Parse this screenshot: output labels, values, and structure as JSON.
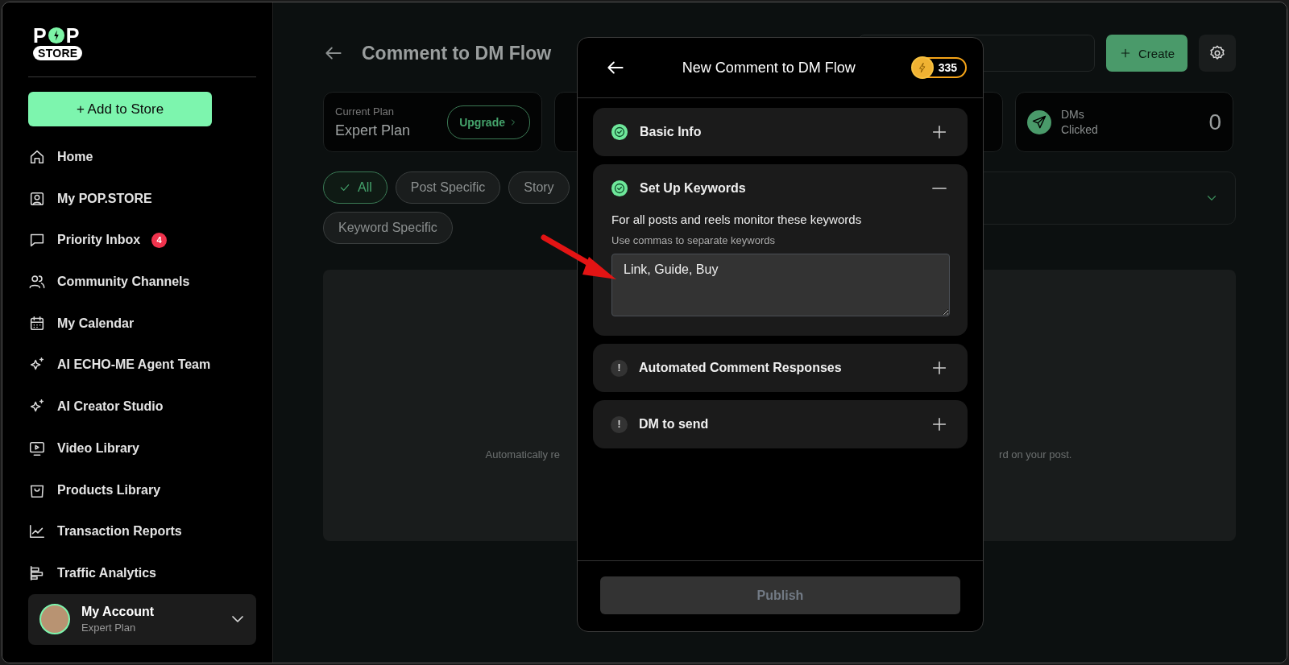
{
  "sidebar": {
    "logo": {
      "left": "P",
      "right": "P",
      "bottom": "STORE"
    },
    "add_button": "+ Add to Store",
    "items": [
      {
        "label": "Home",
        "kind": "home"
      },
      {
        "label": "My POP.STORE",
        "kind": "profile"
      },
      {
        "label": "Priority Inbox",
        "kind": "chat",
        "badge": "4"
      },
      {
        "label": "Community Channels",
        "kind": "people"
      },
      {
        "label": "My Calendar",
        "kind": "calendar"
      },
      {
        "label": "AI ECHO-ME Agent Team",
        "kind": "sparkle"
      },
      {
        "label": "AI Creator Studio",
        "kind": "sparkle"
      },
      {
        "label": "Video Library",
        "kind": "video"
      },
      {
        "label": "Products Library",
        "kind": "bag"
      },
      {
        "label": "Transaction Reports",
        "kind": "chart"
      },
      {
        "label": "Traffic Analytics",
        "kind": "bars"
      }
    ],
    "account": {
      "name": "My Account",
      "plan": "Expert Plan"
    }
  },
  "main": {
    "title": "Comment to DM Flow",
    "create_button": "Create",
    "stats": [
      {
        "kind": "plan",
        "label": "Current Plan",
        "value": "Expert Plan",
        "button": "Upgrade"
      },
      {
        "kind": "covered"
      },
      {
        "kind": "covered"
      },
      {
        "kind": "metric",
        "label": "DMs Clicked",
        "value": "0"
      }
    ],
    "filters": [
      {
        "label": "All",
        "selected": true
      },
      {
        "label": "Post Specific",
        "selected": false
      },
      {
        "label": "Story",
        "selected": false
      },
      {
        "label": "Keyword Specific",
        "selected": false
      }
    ],
    "empty_text": {
      "left": "Automatically re",
      "right": "rd on your post."
    }
  },
  "modal": {
    "title": "New Comment to DM Flow",
    "credits": "335",
    "sections": [
      {
        "title": "Basic Info",
        "complete": true,
        "expanded": false
      },
      {
        "title": "Set Up Keywords",
        "complete": true,
        "expanded": true,
        "description": "For all posts and reels monitor these keywords",
        "hint": "Use commas to separate keywords",
        "value": "Link, Guide, Buy"
      },
      {
        "title": "Automated Comment Responses",
        "complete": false,
        "mark": "!",
        "expanded": false
      },
      {
        "title": "DM to send",
        "complete": false,
        "mark": "!",
        "expanded": false
      }
    ],
    "publish": {
      "label": "Publish",
      "disabled": true
    }
  }
}
